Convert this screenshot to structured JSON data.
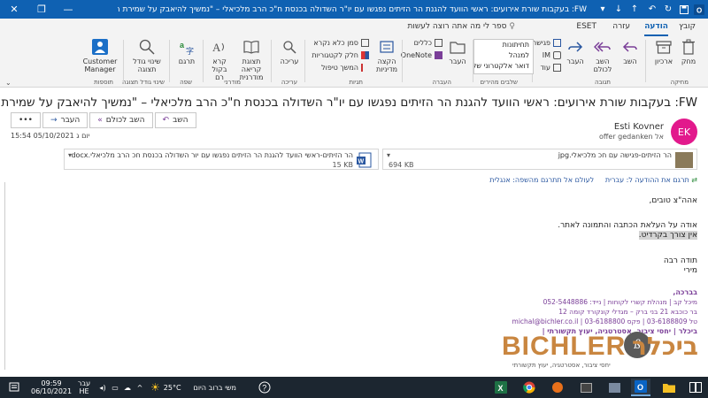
{
  "titlebar": {
    "title": "FW: בעקבות שורת אירועים: ראשי הוועד להגנת הר הזיתים נפגשו עם יו\"ר השדולה בכנסת ח\"כ הרב מלכיאלי – \"נמשיך להיאבק על שמירת הר הזיתים\" - הודעה (...",
    "minimize": "—",
    "restore": "❐",
    "close": "✕"
  },
  "tabs": {
    "file": "קובץ",
    "message": "הודעה",
    "help": "עזרה",
    "eset": "ESET",
    "tellme": "ספר לי מה אתה רוצה לעשות"
  },
  "ribbon": {
    "delete": "מחק",
    "archive": "ארכיון",
    "reply": "השב",
    "reply_all": "השב לכולם",
    "forward": "העבר",
    "meeting": "פגישה",
    "im": "IM",
    "more": "עוד",
    "qs_1": "תחיתונות",
    "qs_2": "למנהל",
    "qs_3": "דואר אלקטרוני של צוות",
    "move": "העבר",
    "rules": "כללים",
    "onenote": "OneNote",
    "assign_policy": "הקצה מדיניות",
    "mark_unread": "סמן כלא נקרא",
    "categorize": "חלק לקטגוריות",
    "follow_up": "המשך טיפול",
    "edit": "עריכה",
    "immersive_reader": "תצוגת קריאה מודרנית",
    "read_aloud": "קרא בקול רם",
    "translate": "תרגם",
    "zoom": "שינוי גודל תצוגה",
    "customer_manager_1": "Customer",
    "customer_manager_2": "Manager",
    "groups": {
      "delete": "מחיקה",
      "respond": "תגובה",
      "quicksteps": "שלבים מהירים",
      "move": "העברה",
      "tags": "תגיות",
      "editing": "עריכה",
      "immersive": "מודרני",
      "language": "שפה",
      "zoom": "שינוי גודל תצוגה",
      "bichler": "תוספות"
    }
  },
  "message": {
    "subject": "FW:  בעקבות שורת אירועים: ראשי הוועד להגנת הר הזיתים נפגשו עם יו\"ר השדולה בכנסת ח\"כ הרב מלכיאלי – \"נמשיך להיאבק על שמירת הר הזי...",
    "avatar_initials": "EK",
    "sender": "Esti Kovner",
    "to_label": "אל",
    "to": "offer gedanken",
    "date": "יום ג 05/10/2021 15:54",
    "reply": "השב",
    "reply_all": "השב לכולם",
    "forward": "העבר",
    "more": "•••"
  },
  "attachments": [
    {
      "name": "הר הזיתים-פגישה עם חכ מלכיאלי.jpg",
      "size": "694 KB"
    },
    {
      "name": "הר הזיתים-ראשי הוועד להגנת הר הזיתים נפגשו עם יור השדולה בכנסת חכ הרב מלכיאלי.docx",
      "size": "15 KB"
    }
  ],
  "translate_bar": {
    "translate": "תרגם את ההודעה ל: עברית",
    "never": "לעולם אל תתרגם מהשפה: אנגלית"
  },
  "body": {
    "greeting": "אהה\"צ טובים,",
    "thanks": "אודה על העלאת הכתבה והתמונה לאתר.",
    "no_credit": "אין צורך בקרדיט.",
    "sign1": "תודה רבה",
    "sign2": "מירי"
  },
  "signature": {
    "regards": "בברכה,",
    "line1": "מיכל קב | מנהלת קשרי לקוחות | נייד: 052-5448886",
    "line2": "בר כוכבא 21 בני ברק – מגדלי קונקורד קומה 12",
    "line3": "טל 03-6188809 | פקס 03-6188800 | michal@bichler.co.il",
    "line4": "ביכלר | יחסי ציבור, אסטרטגיה, יעוץ תקשורתי |",
    "logo_en": "BICHLER",
    "logo_he": "ביכלר",
    "logo_tag": "יחסי ציבור, אסטרטגיה, יעוץ תקשורתי"
  },
  "taskbar": {
    "time": "09:59",
    "date": "06/10/2021",
    "lang_1": "עבר",
    "lang_2": "HE",
    "weather_temp": "25°C",
    "weather_text": "משי ברוב היום"
  }
}
